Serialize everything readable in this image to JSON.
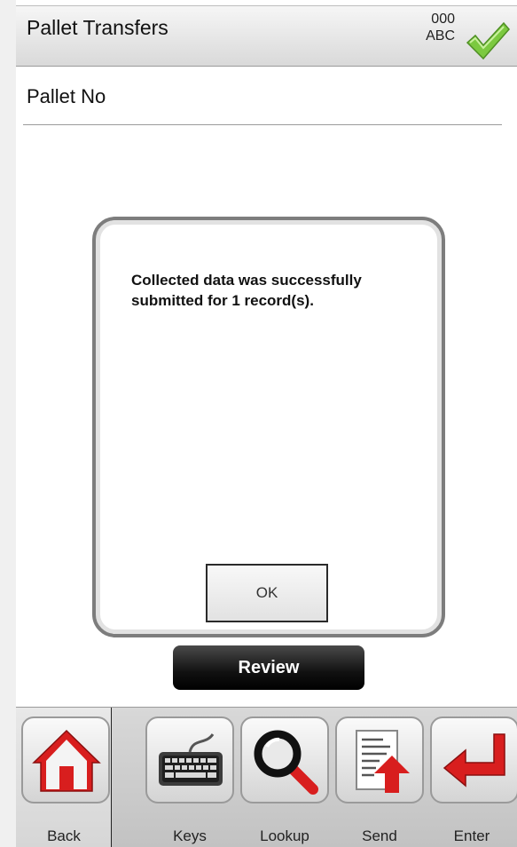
{
  "header": {
    "title": "Pallet Transfers",
    "status_top": "000",
    "status_bottom": "ABC"
  },
  "form": {
    "field_label": "Pallet No"
  },
  "dialog": {
    "message": "Collected data was successfully submitted for 1 record(s).",
    "ok_label": "OK"
  },
  "review_label": "Review",
  "toolbar": {
    "buttons": [
      {
        "label": "Back",
        "icon": "home-icon"
      },
      {
        "label": "Keys",
        "icon": "keyboard-icon"
      },
      {
        "label": "Lookup",
        "icon": "magnifier-icon"
      },
      {
        "label": "Send",
        "icon": "send-document-icon"
      },
      {
        "label": "Enter",
        "icon": "enter-arrow-icon"
      }
    ]
  },
  "colors": {
    "accent_red": "#d81e1e",
    "check_green": "#7cc940"
  }
}
